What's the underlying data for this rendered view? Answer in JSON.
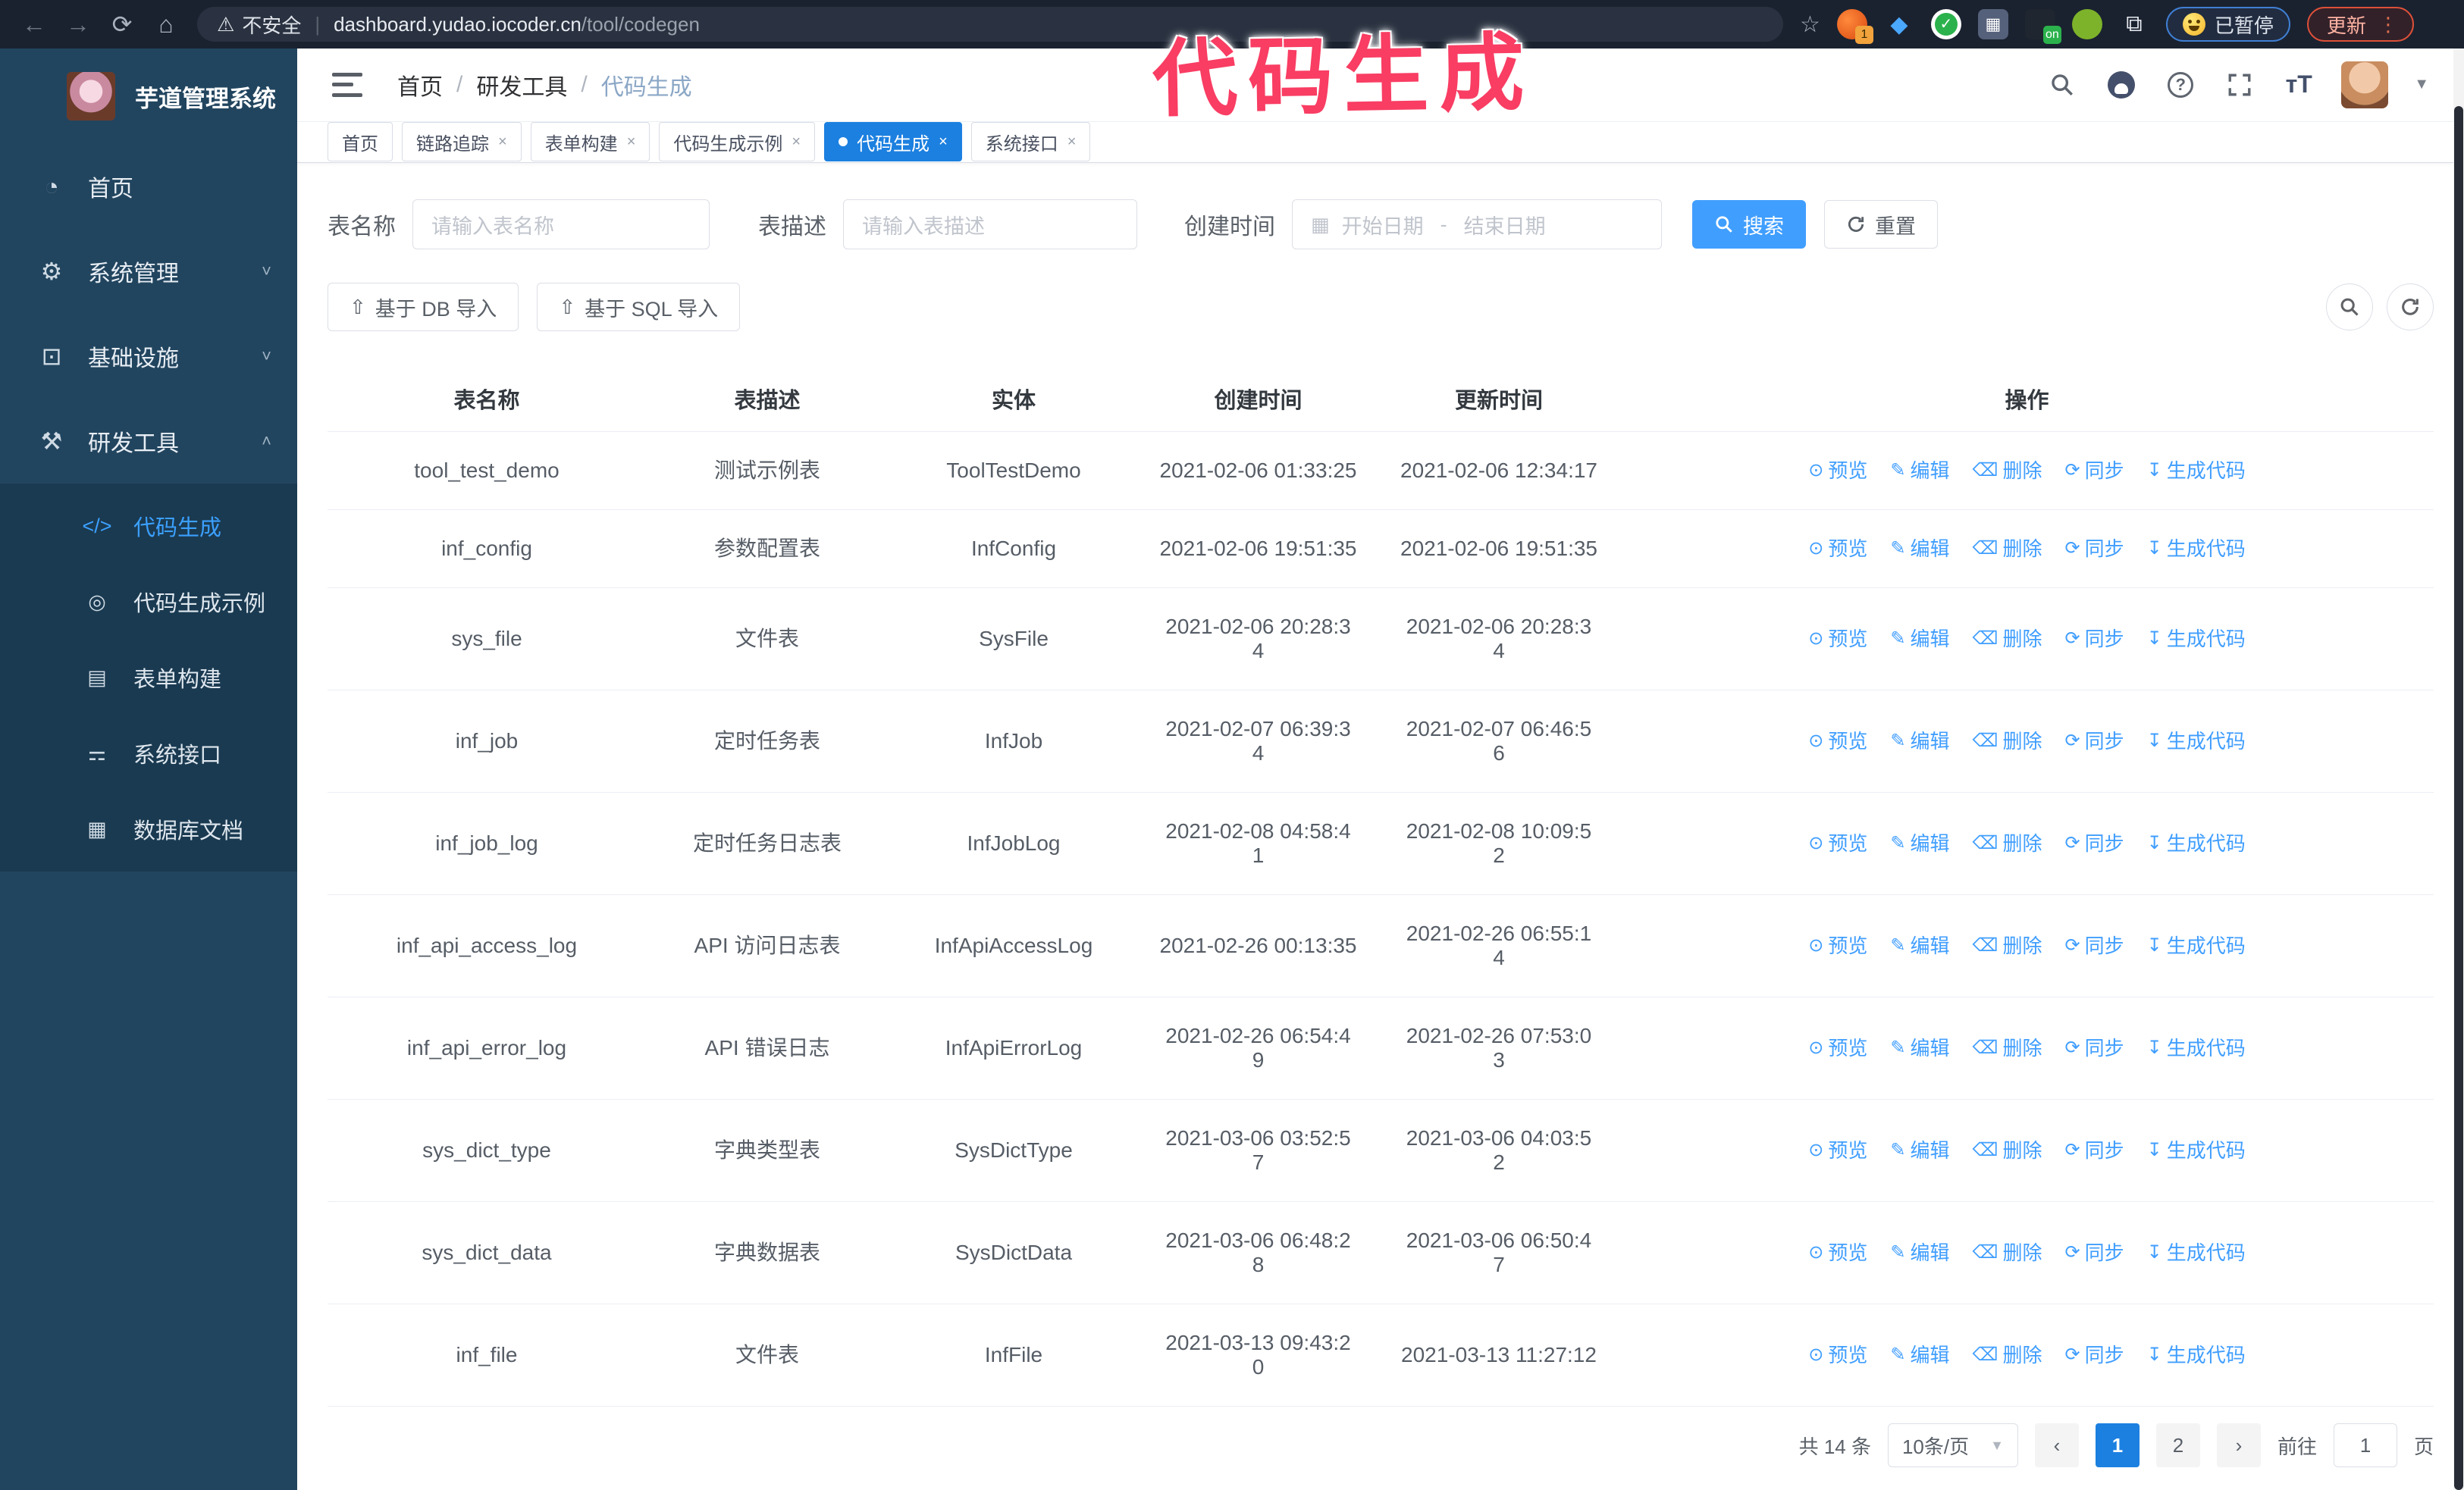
{
  "browser": {
    "security_label": "不安全",
    "url_domain": "dashboard.yudao.iocoder.cn",
    "url_path": "/tool/codegen",
    "extension_badge": "1",
    "extension_on_badge": "on",
    "paused_badge": "已暂停",
    "update_button": "更新"
  },
  "annotation": {
    "text": "代码生成",
    "color": "#f93d63"
  },
  "sidebar": {
    "logo_title": "芋道管理系统",
    "items": [
      {
        "label": "首页",
        "icon": "dashboard-icon"
      },
      {
        "label": "系统管理",
        "icon": "gear-icon",
        "caret": "˅"
      },
      {
        "label": "基础设施",
        "icon": "monitor-icon",
        "caret": "˅"
      },
      {
        "label": "研发工具",
        "icon": "toolbox-icon",
        "caret": "˄"
      }
    ],
    "subitems": [
      {
        "label": "代码生成",
        "icon": "code-icon",
        "active": true
      },
      {
        "label": "代码生成示例",
        "icon": "example-icon"
      },
      {
        "label": "表单构建",
        "icon": "form-icon"
      },
      {
        "label": "系统接口",
        "icon": "api-icon"
      },
      {
        "label": "数据库文档",
        "icon": "database-icon"
      }
    ]
  },
  "breadcrumb": {
    "items": [
      "首页",
      "研发工具",
      "代码生成"
    ],
    "separator": "/"
  },
  "tabs": [
    {
      "label": "首页",
      "closable": false,
      "active": false
    },
    {
      "label": "链路追踪",
      "closable": true,
      "active": false
    },
    {
      "label": "表单构建",
      "closable": true,
      "active": false
    },
    {
      "label": "代码生成示例",
      "closable": true,
      "active": false
    },
    {
      "label": "代码生成",
      "closable": true,
      "active": true
    },
    {
      "label": "系统接口",
      "closable": true,
      "active": false
    }
  ],
  "search_form": {
    "table_name_label": "表名称",
    "table_name_placeholder": "请输入表名称",
    "table_desc_label": "表描述",
    "table_desc_placeholder": "请输入表描述",
    "create_time_label": "创建时间",
    "date_start_placeholder": "开始日期",
    "date_separator": "-",
    "date_end_placeholder": "结束日期",
    "search_button": "搜索",
    "reset_button": "重置"
  },
  "toolbar": {
    "import_db_button": "基于 DB 导入",
    "import_sql_button": "基于 SQL 导入"
  },
  "table": {
    "columns": [
      "表名称",
      "表描述",
      "实体",
      "创建时间",
      "更新时间",
      "操作"
    ],
    "actions": [
      "预览",
      "编辑",
      "删除",
      "同步",
      "生成代码"
    ],
    "rows": [
      {
        "name": "tool_test_demo",
        "desc": "测试示例表",
        "entity": "ToolTestDemo",
        "created": "2021-02-06 01:33:25",
        "updated": "2021-02-06 12:34:17"
      },
      {
        "name": "inf_config",
        "desc": "参数配置表",
        "entity": "InfConfig",
        "created": "2021-02-06 19:51:35",
        "updated": "2021-02-06 19:51:35"
      },
      {
        "name": "sys_file",
        "desc": "文件表",
        "entity": "SysFile",
        "created": "2021-02-06 20:28:3\n4",
        "updated": "2021-02-06 20:28:3\n4"
      },
      {
        "name": "inf_job",
        "desc": "定时任务表",
        "entity": "InfJob",
        "created": "2021-02-07 06:39:3\n4",
        "updated": "2021-02-07 06:46:5\n6"
      },
      {
        "name": "inf_job_log",
        "desc": "定时任务日志表",
        "entity": "InfJobLog",
        "created": "2021-02-08 04:58:4\n1",
        "updated": "2021-02-08 10:09:5\n2"
      },
      {
        "name": "inf_api_access_log",
        "desc": "API 访问日志表",
        "entity": "InfApiAccessLog",
        "created": "2021-02-26 00:13:35",
        "updated": "2021-02-26 06:55:1\n4"
      },
      {
        "name": "inf_api_error_log",
        "desc": "API 错误日志",
        "entity": "InfApiErrorLog",
        "created": "2021-02-26 06:54:4\n9",
        "updated": "2021-02-26 07:53:0\n3"
      },
      {
        "name": "sys_dict_type",
        "desc": "字典类型表",
        "entity": "SysDictType",
        "created": "2021-03-06 03:52:5\n7",
        "updated": "2021-03-06 04:03:5\n2"
      },
      {
        "name": "sys_dict_data",
        "desc": "字典数据表",
        "entity": "SysDictData",
        "created": "2021-03-06 06:48:2\n8",
        "updated": "2021-03-06 06:50:4\n7"
      },
      {
        "name": "inf_file",
        "desc": "文件表",
        "entity": "InfFile",
        "created": "2021-03-13 09:43:2\n0",
        "updated": "2021-03-13 11:27:12"
      }
    ]
  },
  "pagination": {
    "total": "共 14 条",
    "page_size": "10条/页",
    "pages": [
      "1",
      "2"
    ],
    "active_page": "1",
    "goto_label": "前往",
    "goto_value": "1",
    "goto_suffix": "页"
  }
}
